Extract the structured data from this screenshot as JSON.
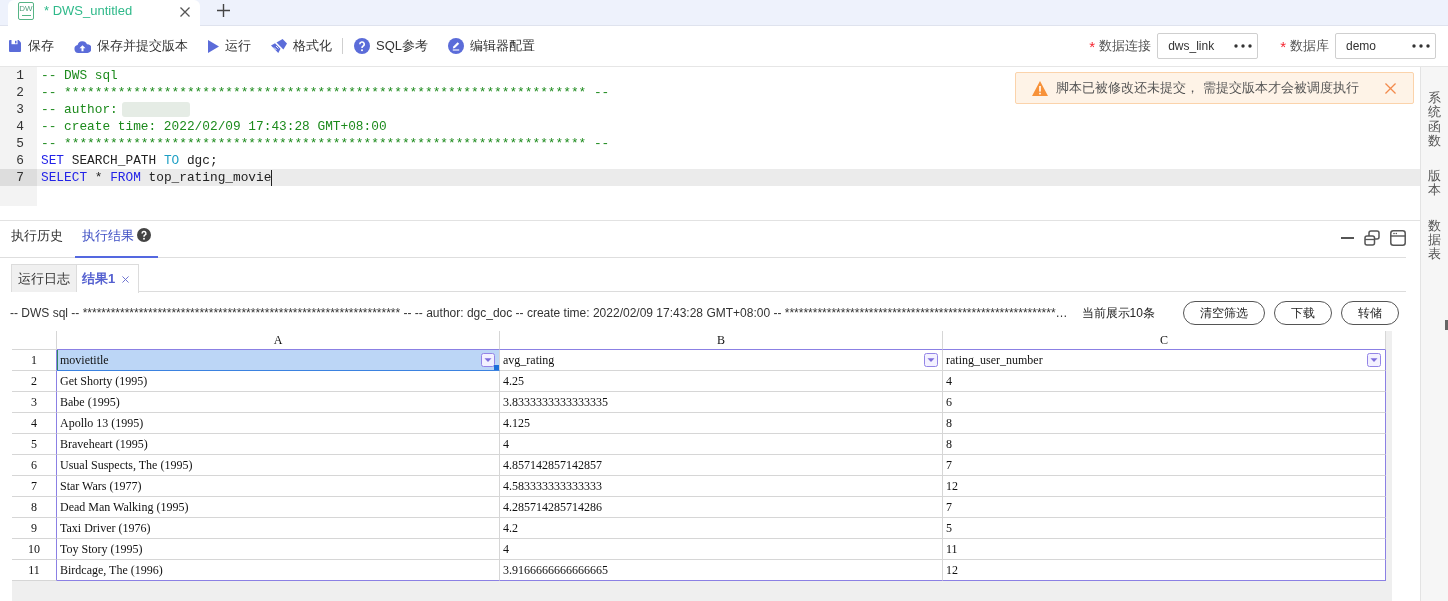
{
  "tabs": [
    {
      "badge": "DW",
      "label": "* DWS_untitled",
      "selected": true,
      "closable": true
    }
  ],
  "toolbar": {
    "groups": [
      {
        "actions": [
          {
            "label": "保存"
          },
          {
            "label": "保存并提交版本"
          },
          {
            "label": "运行"
          },
          {
            "label": "格式化"
          }
        ]
      },
      {
        "actions": [
          {
            "label": "SQL参考"
          },
          {
            "label": "编辑器配置"
          }
        ]
      }
    ],
    "fields": [
      {
        "required_mark": "*",
        "label": "数据连接",
        "value": "dws_link"
      },
      {
        "required_mark": "*",
        "label": "数据库",
        "value": "demo"
      }
    ]
  },
  "editor": {
    "lines": [
      {
        "number": "1",
        "current": false,
        "tokens": [
          {
            "kind": "comment",
            "text": "-- DWS sql"
          }
        ]
      },
      {
        "number": "2",
        "current": false,
        "tokens": [
          {
            "kind": "comment",
            "text": "-- ******************************************************************** --"
          }
        ]
      },
      {
        "number": "3",
        "current": false,
        "tokens": [
          {
            "kind": "comment",
            "text": "-- author:"
          },
          {
            "kind": "blurred"
          }
        ]
      },
      {
        "number": "4",
        "current": false,
        "tokens": [
          {
            "kind": "comment",
            "text": "-- create time: 2022/02/09 17:43:28 GMT+08:00"
          }
        ]
      },
      {
        "number": "5",
        "current": false,
        "tokens": [
          {
            "kind": "comment",
            "text": "-- ******************************************************************** --"
          }
        ]
      },
      {
        "number": "6",
        "current": false,
        "tokens": [
          {
            "kind": "keyword",
            "text": "SET"
          },
          {
            "kind": "plain",
            "text": " SEARCH_PATH "
          },
          {
            "kind": "builtin",
            "text": "TO"
          },
          {
            "kind": "plain",
            "text": " dgc;"
          }
        ]
      },
      {
        "number": "7",
        "current": true,
        "tokens": [
          {
            "kind": "keyword",
            "text": "SELECT"
          },
          {
            "kind": "plain",
            "text": " * "
          },
          {
            "kind": "keyword",
            "text": "FROM"
          },
          {
            "kind": "plain",
            "text": " top_rating_movie"
          }
        ]
      }
    ]
  },
  "notification": {
    "message": "脚本已被修改还未提交， 需提交版本才会被调度执行"
  },
  "results": {
    "tabs": [
      {
        "label": "执行历史",
        "selected": false,
        "help": false
      },
      {
        "label": "执行结果",
        "selected": true,
        "help": true
      }
    ],
    "subtabs": [
      {
        "label": "运行日志",
        "selected": false,
        "closable": false
      },
      {
        "label": "结果1",
        "selected": true,
        "closable": true
      }
    ],
    "query": "-- DWS sql -- ******************************************************************** -- -- author: dgc_doc -- create time: 2022/02/09 17:43:28 GMT+08:00 -- **********************************************************…",
    "row_count": "当前展示10条",
    "buttons": [
      {
        "label": "清空筛选"
      },
      {
        "label": "下载"
      },
      {
        "label": "转储"
      }
    ],
    "sheet": {
      "columns": [
        "A",
        "B",
        "C"
      ],
      "rows": [
        {
          "number": "1",
          "kind": "header",
          "cells": [
            {
              "text": "movietitle",
              "selected": true
            },
            {
              "text": "avg_rating",
              "selected": false
            },
            {
              "text": "rating_user_number",
              "selected": false
            }
          ]
        },
        {
          "number": "2",
          "kind": "data",
          "cells": [
            {
              "text": "Get Shorty (1995)",
              "selected": false
            },
            {
              "text": "4.25",
              "selected": false
            },
            {
              "text": "4",
              "selected": false
            }
          ]
        },
        {
          "number": "3",
          "kind": "data",
          "cells": [
            {
              "text": "Babe (1995)",
              "selected": false
            },
            {
              "text": "3.8333333333333335",
              "selected": false
            },
            {
              "text": "6",
              "selected": false
            }
          ]
        },
        {
          "number": "4",
          "kind": "data",
          "cells": [
            {
              "text": "Apollo 13 (1995)",
              "selected": false
            },
            {
              "text": "4.125",
              "selected": false
            },
            {
              "text": "8",
              "selected": false
            }
          ]
        },
        {
          "number": "5",
          "kind": "data",
          "cells": [
            {
              "text": "Braveheart (1995)",
              "selected": false
            },
            {
              "text": "4",
              "selected": false
            },
            {
              "text": "8",
              "selected": false
            }
          ]
        },
        {
          "number": "6",
          "kind": "data",
          "cells": [
            {
              "text": "Usual Suspects, The (1995)",
              "selected": false
            },
            {
              "text": "4.857142857142857",
              "selected": false
            },
            {
              "text": "7",
              "selected": false
            }
          ]
        },
        {
          "number": "7",
          "kind": "data",
          "cells": [
            {
              "text": "Star Wars (1977)",
              "selected": false
            },
            {
              "text": "4.583333333333333",
              "selected": false
            },
            {
              "text": "12",
              "selected": false
            }
          ]
        },
        {
          "number": "8",
          "kind": "data",
          "cells": [
            {
              "text": "Dead Man Walking (1995)",
              "selected": false
            },
            {
              "text": "4.285714285714286",
              "selected": false
            },
            {
              "text": "7",
              "selected": false
            }
          ]
        },
        {
          "number": "9",
          "kind": "data",
          "cells": [
            {
              "text": "Taxi Driver (1976)",
              "selected": false
            },
            {
              "text": "4.2",
              "selected": false
            },
            {
              "text": "5",
              "selected": false
            }
          ]
        },
        {
          "number": "10",
          "kind": "data",
          "cells": [
            {
              "text": "Toy Story (1995)",
              "selected": false
            },
            {
              "text": "4",
              "selected": false
            },
            {
              "text": "11",
              "selected": false
            }
          ]
        },
        {
          "number": "11",
          "kind": "data",
          "cells": [
            {
              "text": "Birdcage, The (1996)",
              "selected": false
            },
            {
              "text": "3.9166666666666665",
              "selected": false
            },
            {
              "text": "12",
              "selected": false
            }
          ]
        }
      ]
    }
  },
  "side_panel": {
    "items": [
      {
        "label": "系统函数"
      },
      {
        "label": "版本"
      },
      {
        "label": "数据表"
      }
    ]
  }
}
